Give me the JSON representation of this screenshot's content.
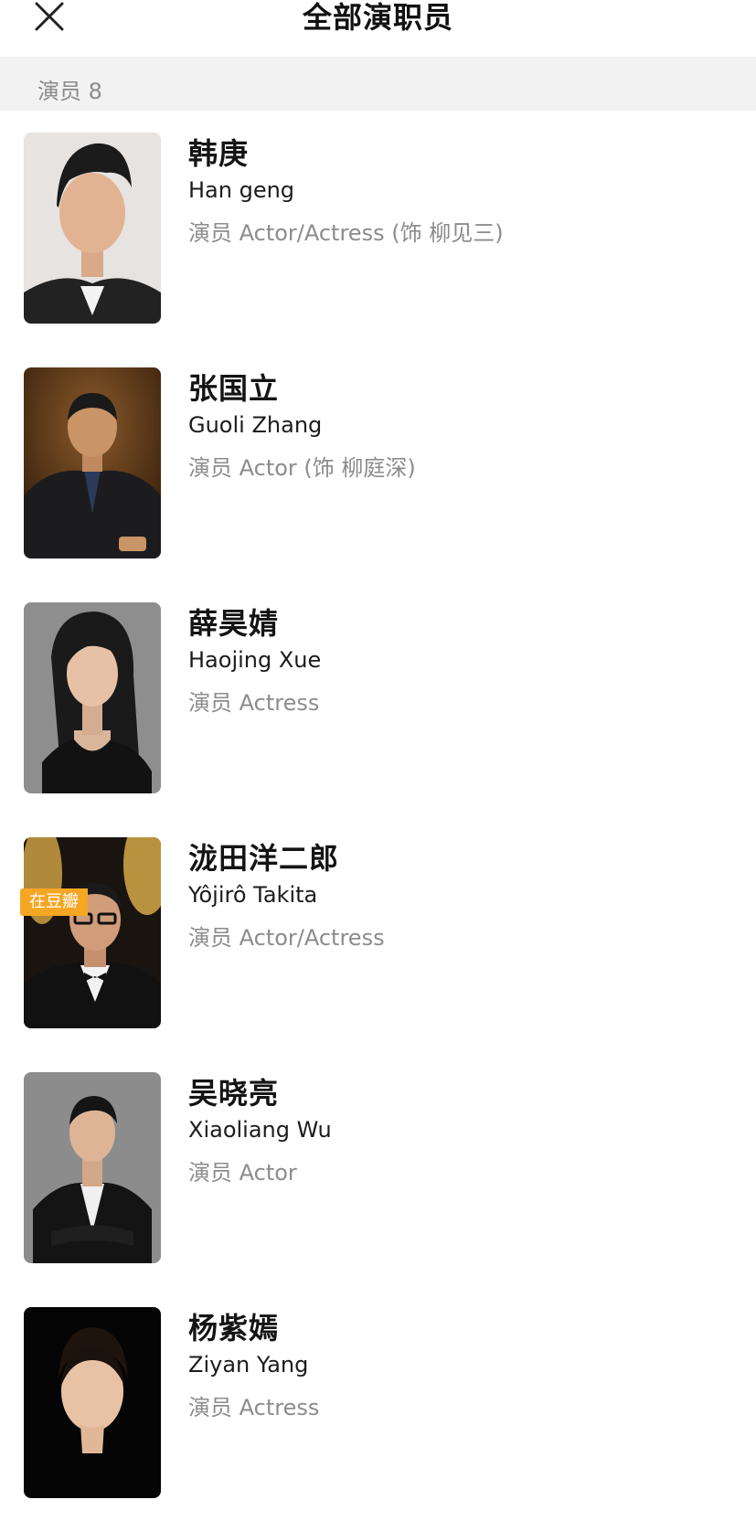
{
  "header": {
    "title": "全部演职员",
    "close_icon": "close-icon"
  },
  "section": {
    "label": "演员 8"
  },
  "cast": [
    {
      "name_cn": "韩庚",
      "name_en": "Han geng",
      "role": "演员 Actor/Actress (饰 柳见三)"
    },
    {
      "name_cn": "张国立",
      "name_en": "Guoli Zhang",
      "role": "演员 Actor (饰 柳庭深)"
    },
    {
      "name_cn": "薛昊婧",
      "name_en": "Haojing Xue",
      "role": "演员 Actress"
    },
    {
      "name_cn": "泷田洋二郎",
      "name_en": "Yôjirô Takita",
      "role": "演员 Actor/Actress",
      "badge": "在豆瓣"
    },
    {
      "name_cn": "吴晓亮",
      "name_en": "Xiaoliang Wu",
      "role": "演员 Actor"
    },
    {
      "name_cn": "杨紫嫣",
      "name_en": "Ziyan Yang",
      "role": "演员 Actress"
    }
  ],
  "colors": {
    "badge": "#f5a623",
    "section_bg": "#f2f2f2",
    "secondary_text": "#8c8c8c"
  }
}
